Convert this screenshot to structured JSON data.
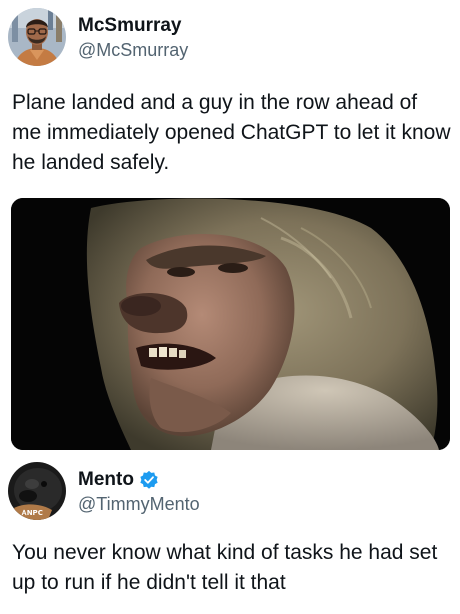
{
  "tweet1": {
    "display_name": "McSmurray",
    "handle": "@McSmurray",
    "text": "Plane landed and a guy in the row ahead of me immediately opened ChatGPT to let it know he landed safely.",
    "avatar_icon": "user-avatar-icon"
  },
  "tweet2": {
    "display_name": "Mento",
    "handle": "@TimmyMento",
    "verified": true,
    "text": "You never know what kind of tasks he had set up to run if he didn't tell it that",
    "avatar_icon": "user-avatar-icon"
  },
  "colors": {
    "text": "#0f1419",
    "secondary": "#536471",
    "verified_blue": "#1d9bf0"
  }
}
